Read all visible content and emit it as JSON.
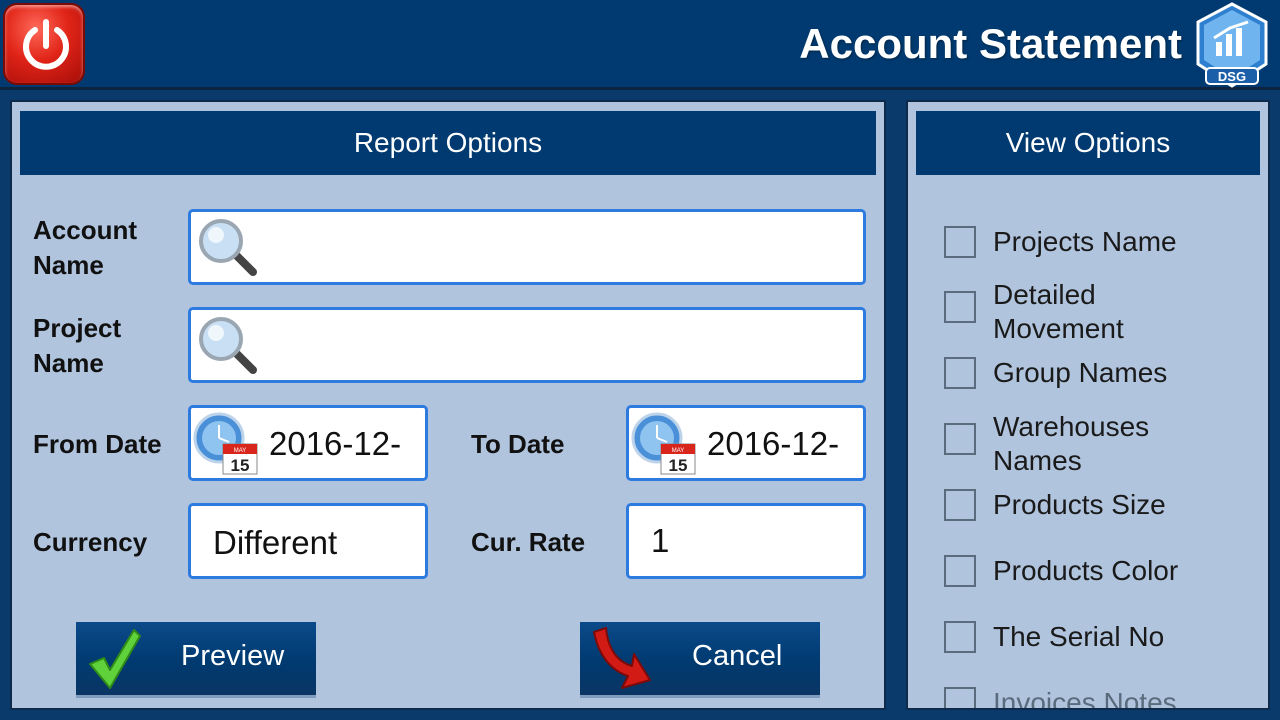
{
  "header": {
    "title": "Account Statement"
  },
  "report_options": {
    "header": "Report Options",
    "account_name": {
      "label": "Account Name",
      "value": ""
    },
    "project_name": {
      "label": "Project Name",
      "value": ""
    },
    "from_date": {
      "label": "From Date",
      "value": "2016-12-"
    },
    "to_date": {
      "label": "To Date",
      "value": "2016-12-"
    },
    "currency": {
      "label": "Currency",
      "value": "Different"
    },
    "cur_rate": {
      "label": "Cur. Rate",
      "value": "1"
    },
    "preview_label": "Preview",
    "cancel_label": "Cancel",
    "calendar_month": "MAY",
    "calendar_day": "15"
  },
  "view_options": {
    "header": "View Options",
    "items": [
      {
        "label": "Projects Name",
        "checked": false
      },
      {
        "label": "Detailed Movement",
        "checked": false
      },
      {
        "label": "Group Names",
        "checked": false
      },
      {
        "label": "Warehouses Names",
        "checked": false
      },
      {
        "label": "Products Size",
        "checked": false
      },
      {
        "label": "Products Color",
        "checked": false
      },
      {
        "label": "The Serial No",
        "checked": false
      },
      {
        "label": "Invoices Notes",
        "checked": false
      }
    ]
  },
  "logo_text": "DSG",
  "colors": {
    "bar": "#003a70",
    "panel": "#b0c4de",
    "field_border": "#2e7be0"
  }
}
